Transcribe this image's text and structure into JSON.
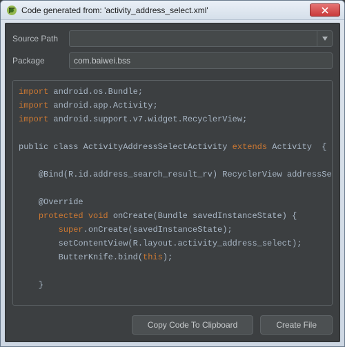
{
  "window": {
    "title": "Code generated from: 'activity_address_select.xml'"
  },
  "form": {
    "source_path_label": "Source Path",
    "source_path_value": "",
    "package_label": "Package",
    "package_value": "com.baiwei.bss"
  },
  "code": {
    "l1_kw": "import",
    "l1_rest": " android.os.Bundle;",
    "l2_kw": "import",
    "l2_rest": " android.app.Activity;",
    "l3_kw": "import",
    "l3_rest": " android.support.v7.widget.RecyclerView;",
    "blank": "",
    "l5a": "public class ",
    "l5b": "ActivityAddressSelectActivity ",
    "l5_kw": "extends",
    "l5c": " Activity  {",
    "l7": "    @Bind(R.id.address_search_result_rv) RecyclerView addressSearchResultRv;",
    "l9": "    @Override",
    "l10a": "    ",
    "l10_kw": "protected void",
    "l10b": " onCreate(Bundle savedInstanceState) {",
    "l11a": "        ",
    "l11_kw": "super",
    "l11b": ".onCreate(savedInstanceState);",
    "l12": "        setContentView(R.layout.activity_address_select);",
    "l13a": "        ButterKnife.bind(",
    "l13_kw": "this",
    "l13b": ");",
    "l15": "    }",
    "l17": "}"
  },
  "buttons": {
    "copy": "Copy Code To Clipboard",
    "create": "Create File"
  }
}
